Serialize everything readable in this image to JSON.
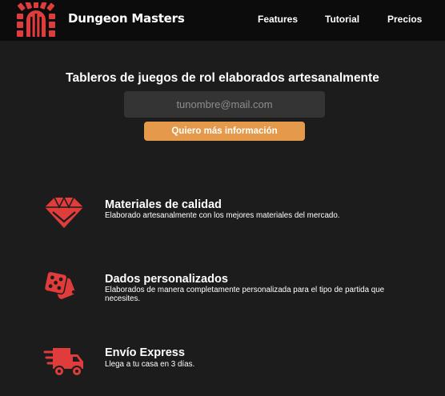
{
  "header": {
    "brand": "Dungeon Masters",
    "nav": [
      {
        "label": "Features"
      },
      {
        "label": "Tutorial"
      },
      {
        "label": "Precios"
      }
    ]
  },
  "hero": {
    "title": "Tableros de juegos de rol elaborados artesanalmente",
    "email_placeholder": "tunombre@mail.com",
    "email_value": "",
    "cta_label": "Quiero más información"
  },
  "features": [
    {
      "icon": "gem-icon",
      "title": "Materiales de calidad",
      "description": "Elaborado artesanalmente con los mejores materiales del mercado."
    },
    {
      "icon": "dice-icon",
      "title": "Dados personalizados",
      "description": "Elaborados de manera completamente personalizada para el tipo de partida que necesites."
    },
    {
      "icon": "shipping-truck-icon",
      "title": "Envío Express",
      "description": "Llega a tu casa en 3 días."
    }
  ],
  "colors": {
    "background": "#1c1c1c",
    "header": "#0c0c0c",
    "accent_red": "#e03c3c",
    "cta_orange": "#e49a4a",
    "input_bg": "#343434"
  }
}
